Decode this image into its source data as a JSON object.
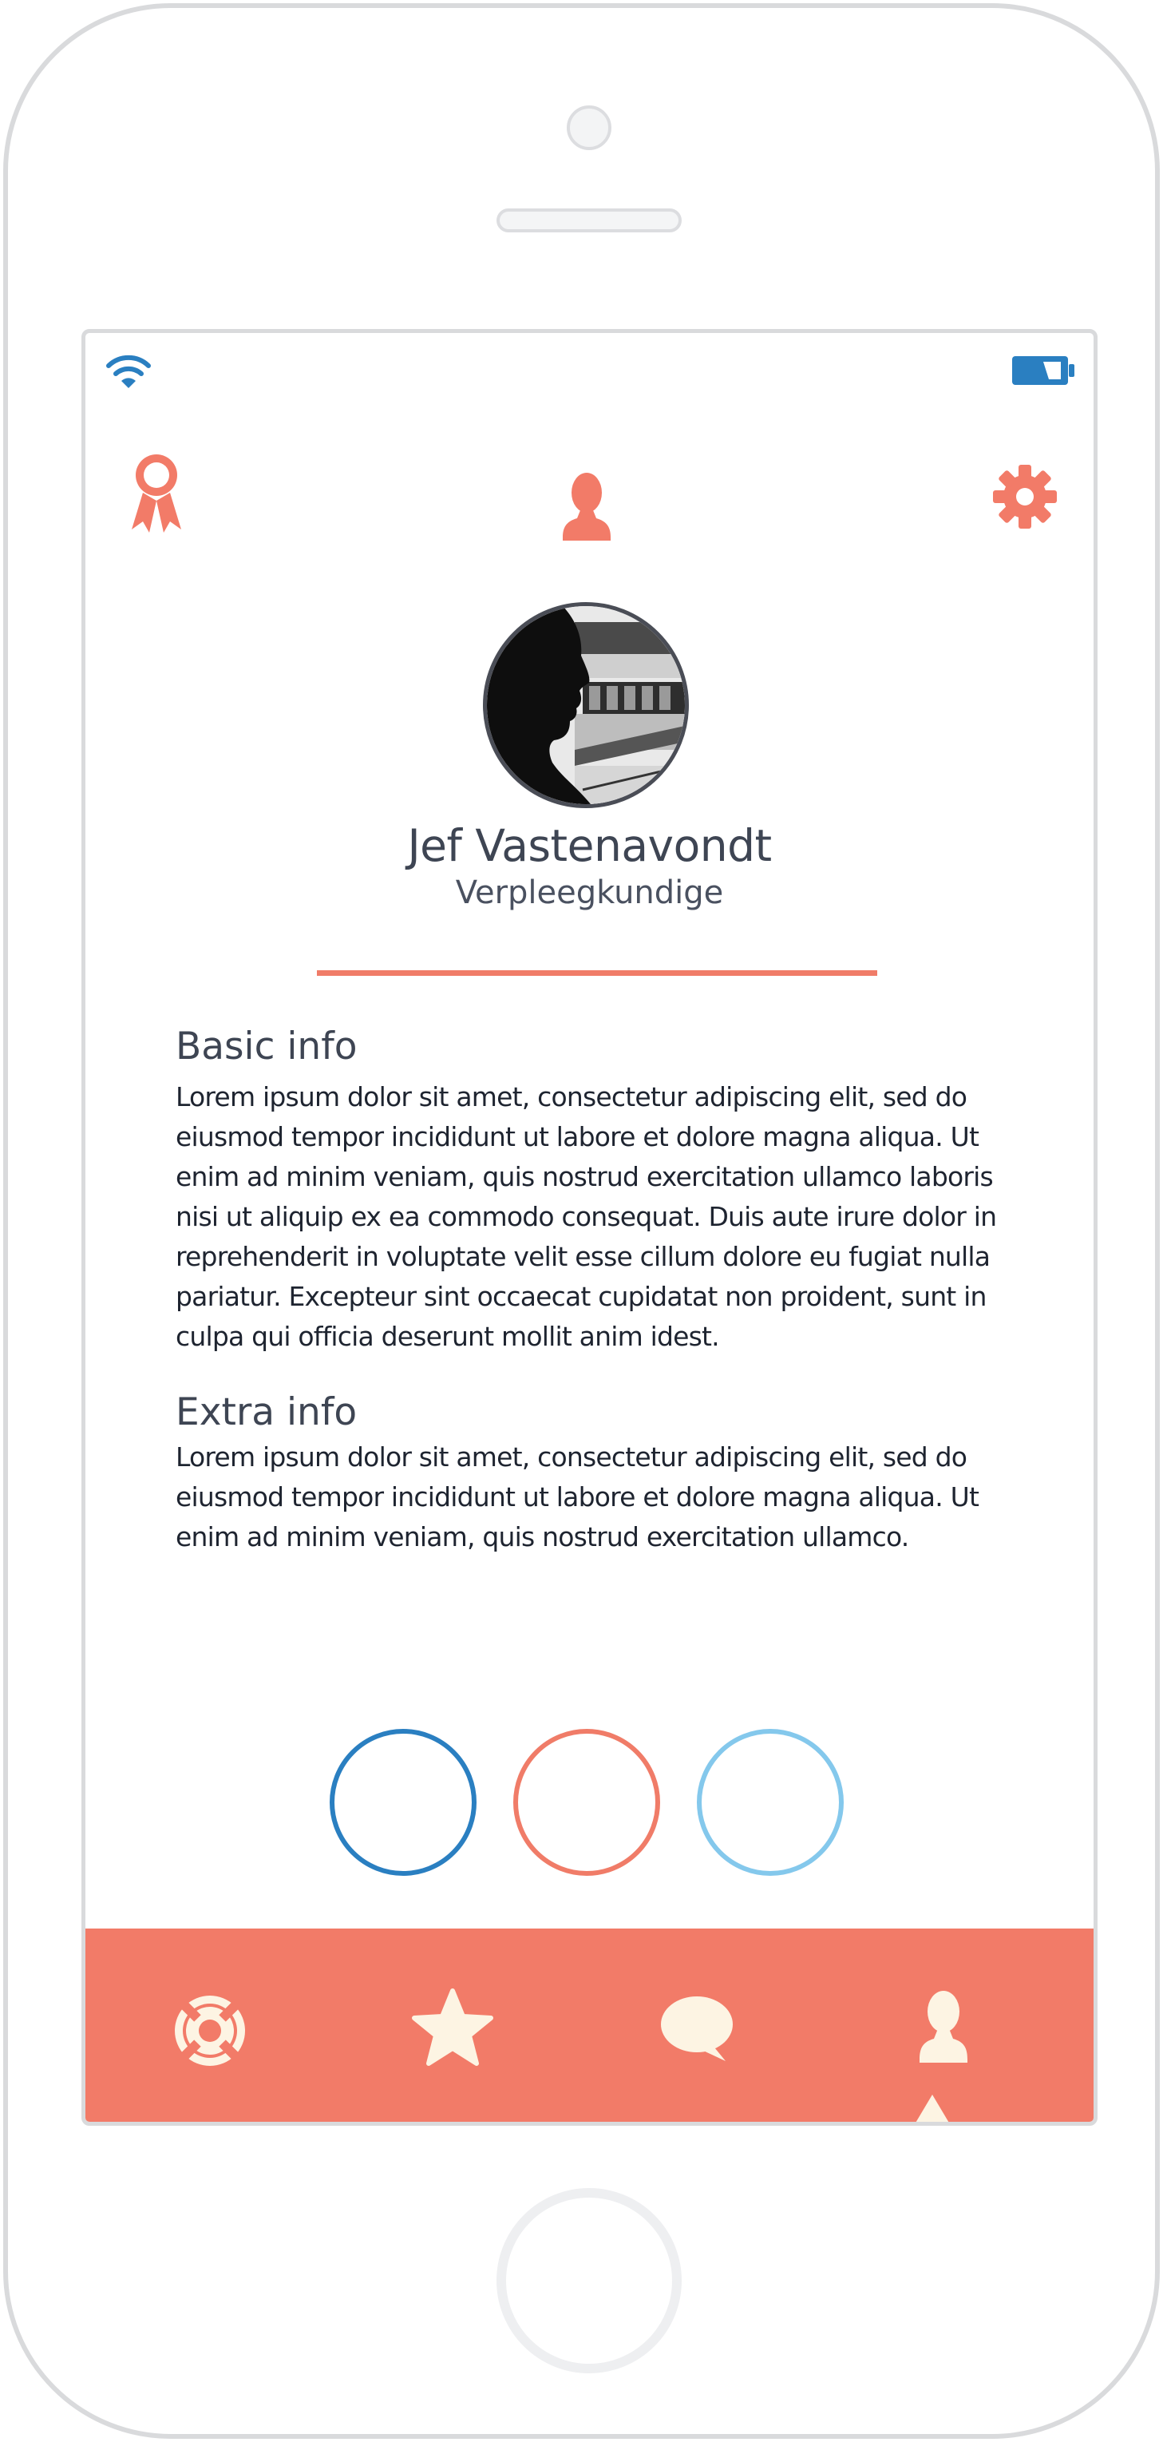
{
  "colors": {
    "accent": "#f27b68",
    "status_blue": "#2a7fc1",
    "light_blue": "#84c8ec",
    "tab_icon": "#fdf4e3",
    "text_dark": "#3e4553"
  },
  "status_bar": {
    "left_icon": "wifi-icon",
    "right_icon": "battery-icon"
  },
  "header": {
    "left_icon": "award-icon",
    "center_icon": "profile-icon",
    "right_icon": "gear-icon"
  },
  "profile": {
    "avatar": "avatar-photo",
    "name": "Jef Vastenavondt",
    "role": "Verpleegkundige"
  },
  "sections": [
    {
      "title": "Basic info",
      "body": "Lorem ipsum dolor sit amet, consectetur adipiscing elit, sed do eiusmod tempor incididunt ut labore et dolore magna aliqua. Ut enim ad minim veniam, quis nostrud exercitation ullamco laboris nisi ut aliquip ex ea commodo consequat. Duis aute irure dolor in reprehenderit in voluptate velit esse cillum dolore eu fugiat nulla pariatur. Excepteur sint occaecat cupidatat non proident, sunt in culpa qui officia deserunt mollit anim idest."
    },
    {
      "title": "Extra info",
      "body": "Lorem ipsum dolor sit amet, consectetur adipiscing elit, sed do eiusmod tempor incididunt ut labore et dolore magna aliqua. Ut enim ad minim veniam, quis nostrud exercitation ullamco."
    }
  ],
  "circles": [
    {
      "color": "#2a7fc1"
    },
    {
      "color": "#f07c68"
    },
    {
      "color": "#84c8ec"
    }
  ],
  "tabbar": {
    "tabs": [
      {
        "icon": "lifebuoy-icon",
        "active": false
      },
      {
        "icon": "star-icon",
        "active": false
      },
      {
        "icon": "chat-bubble-icon",
        "active": false
      },
      {
        "icon": "profile-icon",
        "active": true
      }
    ]
  }
}
